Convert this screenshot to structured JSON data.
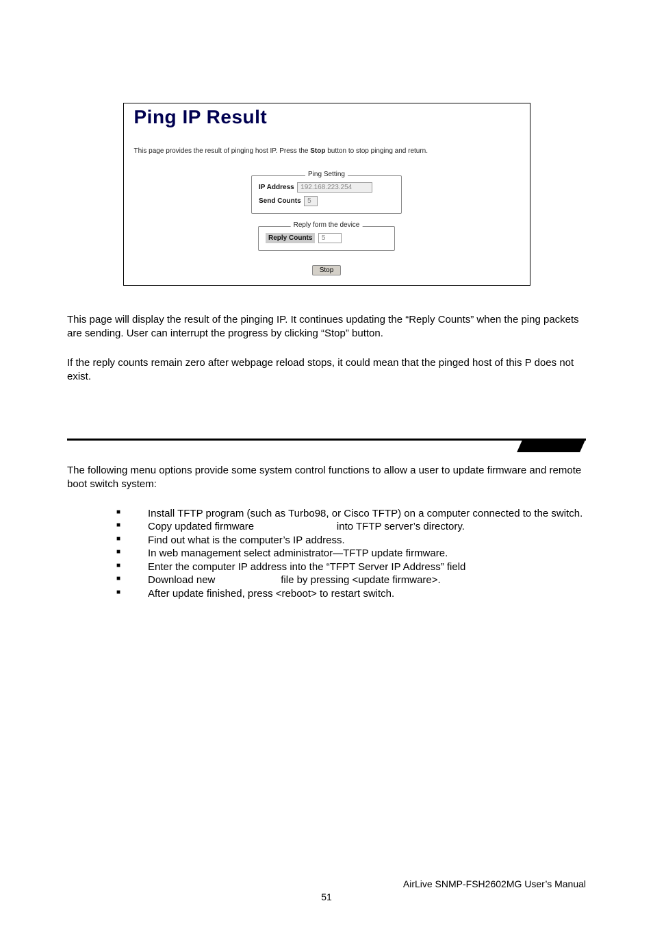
{
  "shot": {
    "title": "Ping IP Result",
    "subtitle_pre": "This page provides the result of pinging host IP. Press the ",
    "subtitle_bold": "Stop",
    "subtitle_post": " button to stop pinging and return.",
    "ping_legend": "Ping Setting",
    "ip_label": "IP Address",
    "ip_value": "192.168.223.254",
    "sc_label": "Send Counts",
    "sc_value": "5",
    "reply_legend": "Reply form the device",
    "rc_label": "Reply Counts",
    "rc_value": "5",
    "stop": "Stop"
  },
  "para1": "This page will display the result of the pinging IP. It continues updating the “Reply Counts” when the ping packets are sending. User can interrupt the progress by clicking “Stop” button.",
  "para2": "If the reply counts remain zero after webpage reload stops, it could mean that the pinged host of this P does not exist.",
  "para3": "The following menu options provide some system control functions to allow a user to update firmware and remote boot switch system:",
  "bul": [
    "Install TFTP program (such as Turbo98, or Cisco TFTP) on a computer connected to the switch.",
    "Copy updated firmware                             into TFTP server’s directory.",
    "Find out what is the computer’s IP address.",
    "In web management select administrator—TFTP update firmware.",
    "Enter the computer IP address into the “TFPT Server IP Address” field",
    "Download new                       file by pressing <update firmware>.",
    "After update finished, press <reboot> to restart switch."
  ],
  "footer_right": "AirLive SNMP-FSH2602MG User’s Manual",
  "footer_page": "51"
}
